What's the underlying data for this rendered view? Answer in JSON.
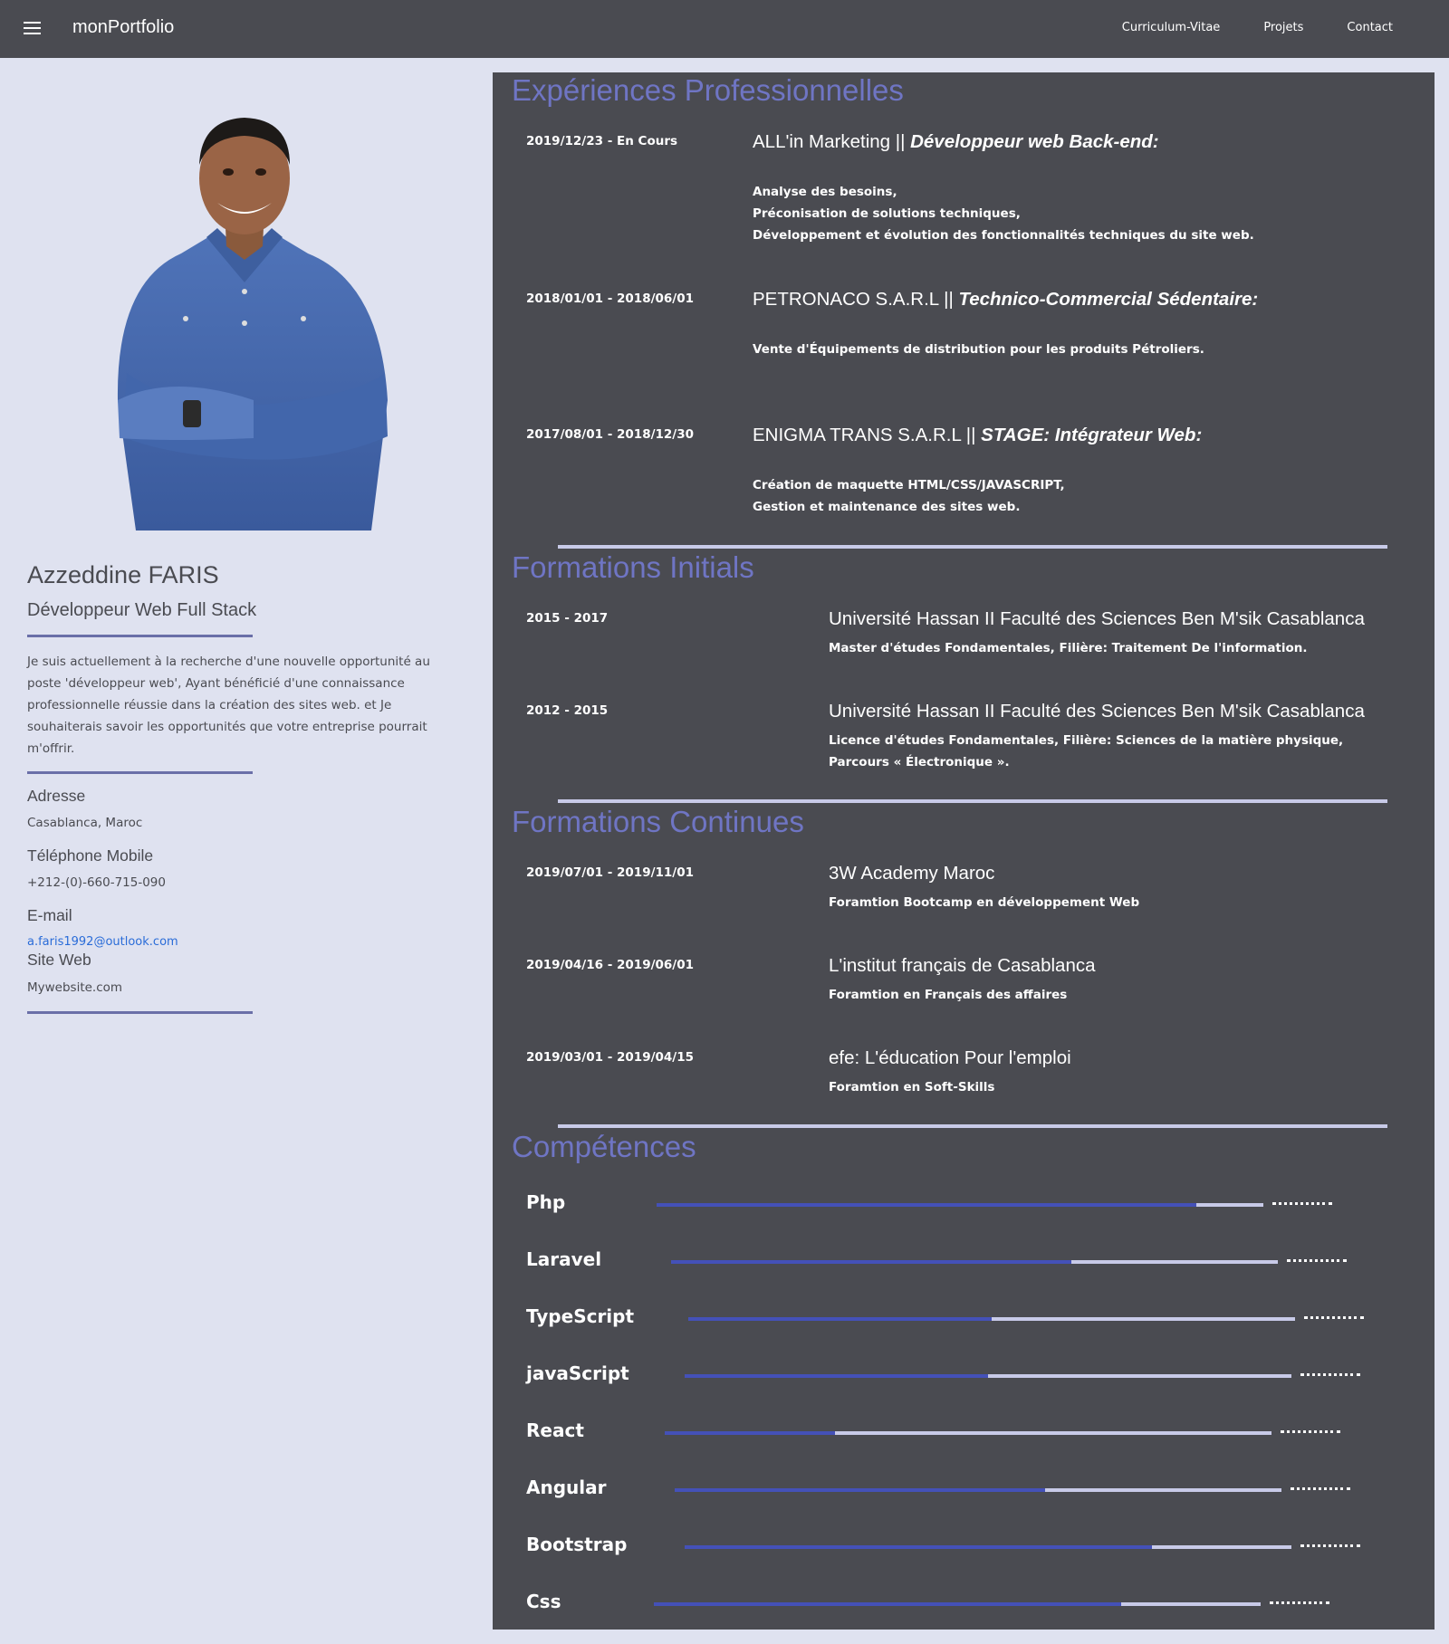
{
  "navbar": {
    "brand": "monPortfolio",
    "links": [
      "Curriculum-Vitae",
      "Projets",
      "Contact"
    ]
  },
  "profile": {
    "name": "Azzeddine FARIS",
    "role": "Développeur Web Full Stack",
    "bio": "Je suis actuellement à la recherche d'une nouvelle opportunité au poste 'développeur web', Ayant bénéficié d'une connaissance professionnelle réussie dans la création des sites web. et Je souhaiterais savoir les opportunités que votre entreprise pourrait m'offrir.",
    "address_label": "Adresse",
    "address": "Casablanca, Maroc",
    "phone_label": "Téléphone Mobile",
    "phone": "+212-(0)-660-715-090",
    "email_label": "E-mail",
    "email": "a.faris1992@outlook.com",
    "website_label": "Site Web",
    "website": "Mywebsite.com"
  },
  "experiences": {
    "title": "Expériences Professionnelles",
    "items": [
      {
        "date": "2019/12/23 - En Cours",
        "company": "ALL'in Marketing || ",
        "position": "Développeur web Back-end:",
        "lines": [
          "Analyse des besoins,",
          "Préconisation de solutions techniques,",
          "Développement et évolution des fonctionnalités techniques du site web."
        ]
      },
      {
        "date": "2018/01/01 - 2018/06/01",
        "company": "PETRONACO S.A.R.L || ",
        "position": "Technico-Commercial Sédentaire:",
        "lines": [
          "Vente d'Équipements de distribution pour les produits Pétroliers."
        ]
      },
      {
        "date": "2017/08/01 - 2018/12/30",
        "company": "ENIGMA TRANS S.A.R.L || ",
        "position": "STAGE: Intégrateur Web:",
        "lines": [
          "Création de maquette HTML/CSS/JAVASCRIPT,",
          "Gestion et maintenance des sites web."
        ]
      }
    ]
  },
  "formations_initiales": {
    "title": "Formations Initials",
    "items": [
      {
        "date": "2015 - 2017",
        "school": "Université Hassan II Faculté des Sciences Ben M'sik Casablanca",
        "desc": "Master d'études Fondamentales, Filière: Traitement De l'information."
      },
      {
        "date": "2012 - 2015",
        "school": "Université Hassan II Faculté des Sciences Ben M'sik Casablanca",
        "desc": "Licence d'études Fondamentales, Filière: Sciences de la matière physique, Parcours « Électronique »."
      }
    ]
  },
  "formations_continues": {
    "title": "Formations Continues",
    "items": [
      {
        "date": "2019/07/01 - 2019/11/01",
        "school": "3W Academy Maroc",
        "desc": "Foramtion Bootcamp en développement Web"
      },
      {
        "date": "2019/04/16 - 2019/06/01",
        "school": "L'institut français de Casablanca",
        "desc": "Foramtion en Français des affaires"
      },
      {
        "date": "2019/03/01 - 2019/04/15",
        "school": "efe: L'éducation Pour l'emploi",
        "desc": "Foramtion en Soft-Skills"
      }
    ]
  },
  "skills": {
    "title": "Compétences",
    "items": [
      {
        "name": "Php",
        "level": 0.89
      },
      {
        "name": "Laravel",
        "level": 0.66
      },
      {
        "name": "TypeScript",
        "level": 0.5
      },
      {
        "name": "javaScript",
        "level": 0.5
      },
      {
        "name": "React",
        "level": 0.28
      },
      {
        "name": "Angular",
        "level": 0.61
      },
      {
        "name": "Bootstrap",
        "level": 0.77
      },
      {
        "name": "Css",
        "level": 0.77
      }
    ]
  },
  "colors": {
    "panel": "#4a4b51",
    "accent": "#6f75c4",
    "bar_fill": "#4451b8",
    "bar_track": "#c8cae8",
    "page_bg": "#dfe2f0"
  }
}
